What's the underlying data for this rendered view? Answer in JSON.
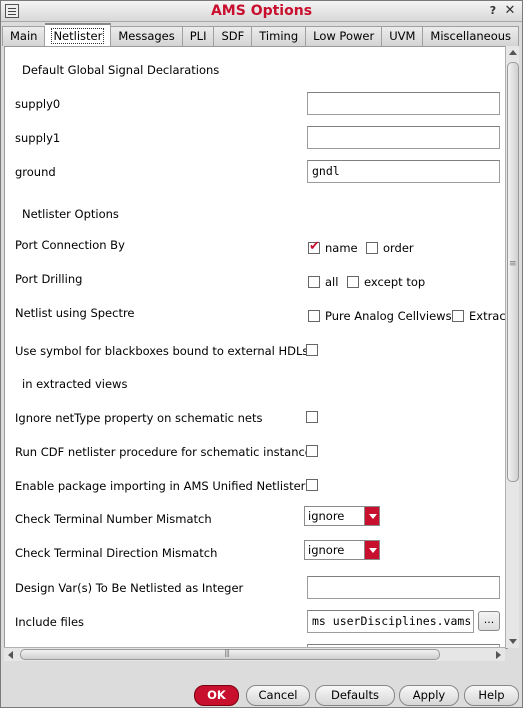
{
  "window": {
    "title": "AMS Options",
    "help_glyph": "?",
    "close_glyph": "✕"
  },
  "tabs": [
    {
      "label": "Main"
    },
    {
      "label": "Netlister"
    },
    {
      "label": "Messages"
    },
    {
      "label": "PLI"
    },
    {
      "label": "SDF"
    },
    {
      "label": "Timing"
    },
    {
      "label": "Low Power"
    },
    {
      "label": "UVM"
    },
    {
      "label": "Miscellaneous"
    }
  ],
  "active_tab": "Netlister",
  "global_signals": {
    "heading": "Default Global Signal Declarations",
    "supply0": {
      "label": "supply0",
      "value": ""
    },
    "supply1": {
      "label": "supply1",
      "value": ""
    },
    "ground": {
      "label": "ground",
      "value": "gndl"
    }
  },
  "netlister_options": {
    "heading": "Netlister Options",
    "port_connection": {
      "label": "Port Connection By",
      "name_label": "name",
      "name_checked": true,
      "order_label": "order",
      "order_checked": false
    },
    "port_drilling": {
      "label": "Port Drilling",
      "all_label": "all",
      "all_checked": false,
      "except_top_label": "except top",
      "except_top_checked": false
    },
    "netlist_spectre": {
      "label": "Netlist using Spectre",
      "pure_analog_label": "Pure Analog Cellviews",
      "pure_analog_checked": false,
      "extract_label": "Extract",
      "extract_checked": false
    },
    "blackbox_symbol": {
      "label": "Use symbol for blackboxes bound to external HDLs",
      "checked": false
    },
    "extracted_views": {
      "label": "in extracted views"
    },
    "ignore_nettype": {
      "label": "Ignore netType property on schematic nets",
      "checked": false
    },
    "run_cdf": {
      "label": "Run CDF netlister procedure for schematic instance",
      "checked": false
    },
    "enable_package": {
      "label": "Enable package importing in AMS Unified Netlister",
      "checked": false
    },
    "term_number": {
      "label": "Check Terminal Number Mismatch",
      "value": "ignore"
    },
    "term_direction": {
      "label": "Check Terminal Direction Mismatch",
      "value": "ignore"
    },
    "design_vars": {
      "label": "Design Var(s) To Be Netlisted as Integer",
      "value": ""
    },
    "include_files": {
      "label": "Include files",
      "value": "ms userDisciplines.vams",
      "browse_label": "..."
    }
  },
  "buttons": {
    "ok": "OK",
    "cancel": "Cancel",
    "defaults": "Defaults",
    "apply": "Apply",
    "help": "Help"
  },
  "colors": {
    "accent": "#c8102e",
    "pane_bg": "#ffffff",
    "window_bg": "#dcdcdc"
  }
}
